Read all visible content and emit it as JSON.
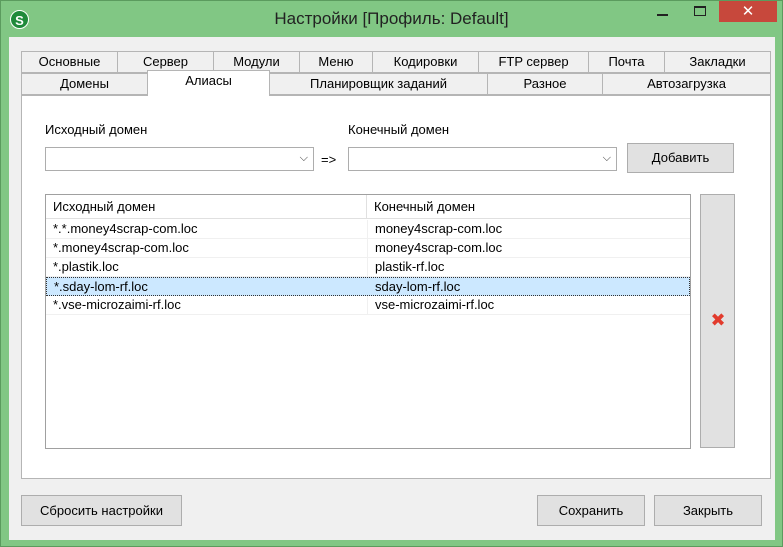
{
  "window": {
    "title": "Настройки [Профиль: Default]",
    "app_icon_letter": "S",
    "min_glyph": "",
    "max_glyph": "",
    "close_glyph": "✕"
  },
  "tabs_row1": [
    "Основные",
    "Сервер",
    "Модули",
    "Меню",
    "Кодировки",
    "FTP сервер",
    "Почта",
    "Закладки"
  ],
  "tabs_row2": [
    "Домены",
    "Алиасы",
    "Планировщик заданий",
    "Разное",
    "Автозагрузка"
  ],
  "active_tab": "Алиасы",
  "aliases": {
    "source_label": "Исходный домен",
    "target_label": "Конечный домен",
    "source_value": "",
    "target_value": "",
    "arrow_text": "=>",
    "add_button": "Добавить",
    "columns": [
      "Исходный домен",
      "Конечный домен"
    ],
    "rows": [
      [
        "*.*.money4scrap-com.loc",
        "money4scrap-com.loc"
      ],
      [
        "*.money4scrap-com.loc",
        "money4scrap-com.loc"
      ],
      [
        "*.plastik.loc",
        "plastik-rf.loc"
      ],
      [
        "*.sday-lom-rf.loc",
        "sday-lom-rf.loc"
      ],
      [
        "*.vse-microzaimi-rf.loc",
        "vse-microzaimi-rf.loc"
      ]
    ],
    "selected_row": 3,
    "delete_icon": "delete-x-icon"
  },
  "footer": {
    "reset_button": "Сбросить настройки",
    "save_button": "Сохранить",
    "close_button": "Закрыть"
  },
  "colors": {
    "titlebar": "#81c784",
    "close": "#c7483c",
    "delete_icon": "#e23b2d",
    "selection": "#cce8ff"
  }
}
